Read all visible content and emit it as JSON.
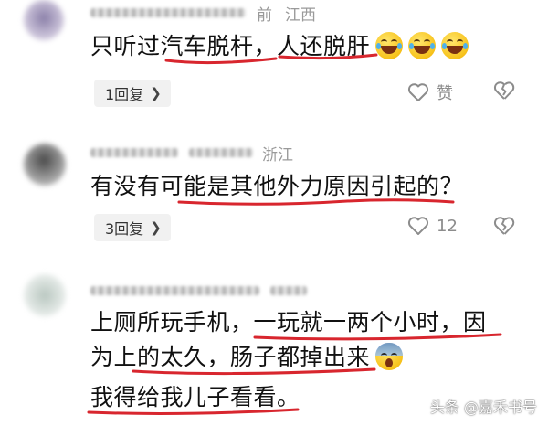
{
  "comments": [
    {
      "time_suffix": "前",
      "location": "江西",
      "text_parts": [
        "只听过汽车脱杆，人还脱肝"
      ],
      "emoji_count": 3,
      "reply_label": "1回复",
      "like_label": "赞"
    },
    {
      "location": "浙江",
      "text_parts": [
        "有没有可能是其他外力原因引起的？"
      ],
      "reply_label": "3回复",
      "like_count": "12"
    },
    {
      "text_lines": [
        "上厕所玩手机，一玩就一两个小时，因",
        "为上的太久，肠子都掉出来",
        "我得给我儿子看看。"
      ]
    }
  ],
  "icons": {
    "like": "heart-outline-icon",
    "dislike": "broken-heart-icon",
    "reply_more": "chevron-right-icon",
    "laugh": "laughing-emoji-icon",
    "shock": "screaming-emoji-icon"
  },
  "colors": {
    "underline": "#d8262e",
    "meta": "#9a9a9a",
    "reply_bg": "#f1f1f1"
  },
  "watermark": "头条 @嘉禾书号"
}
